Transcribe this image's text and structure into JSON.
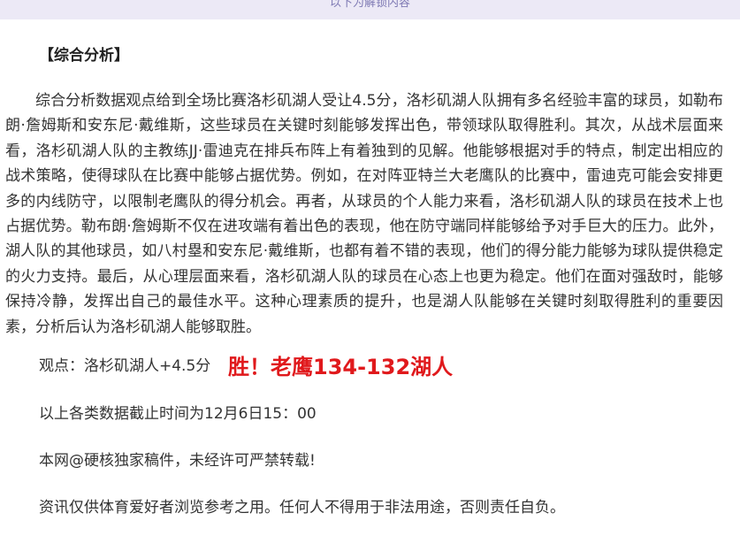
{
  "banner": {
    "text": "以下为解锁内容"
  },
  "article": {
    "section_title": "【综合分析】",
    "paragraph": "综合分析数据观点给到全场比赛洛杉矶湖人受让4.5分，洛杉矶湖人队拥有多名经验丰富的球员，如勒布朗·詹姆斯和安东尼·戴维斯，这些球员在关键时刻能够发挥出色，带领球队取得胜利。其次，从战术层面来看，洛杉矶湖人队的主教练JJ·雷迪克在排兵布阵上有着独到的见解。他能够根据对手的特点，制定出相应的战术策略，使得球队在比赛中能够占据优势。例如，在对阵亚特兰大老鹰队的比赛中，雷迪克可能会安排更多的内线防守，以限制老鹰队的得分机会。再者，从球员的个人能力来看，洛杉矶湖人队的球员在技术上也占据优势。勒布朗·詹姆斯不仅在进攻端有着出色的表现，他在防守端同样能够给予对手巨大的压力。此外，湖人队的其他球员，如八村塁和安东尼·戴维斯，也都有着不错的表现，他们的得分能力能够为球队提供稳定的火力支持。最后，从心理层面来看，洛杉矶湖人队的球员在心态上也更为稳定。他们在面对强敌时，能够保持冷静，发挥出自己的最佳水平。这种心理素质的提升，也是湖人队能够在关键时刻取得胜利的重要因素，分析后认为洛杉矶湖人能够取胜。",
    "viewpoint": "观点：洛杉矶湖人+4.5分",
    "result": "胜！老鹰134-132湖人",
    "data_cutoff": "以上各类数据截止时间为12月6日15：00",
    "copyright": "本网@硬核独家稿件，未经许可严禁转载!",
    "disclaimer": "资讯仅供体育爱好者浏览参考之用。任何人不得用于非法用途，否则责任自负。"
  },
  "colors": {
    "result_red": "#e0191c",
    "banner_bg": "#ece9f6",
    "banner_text": "#7f7ab4"
  }
}
